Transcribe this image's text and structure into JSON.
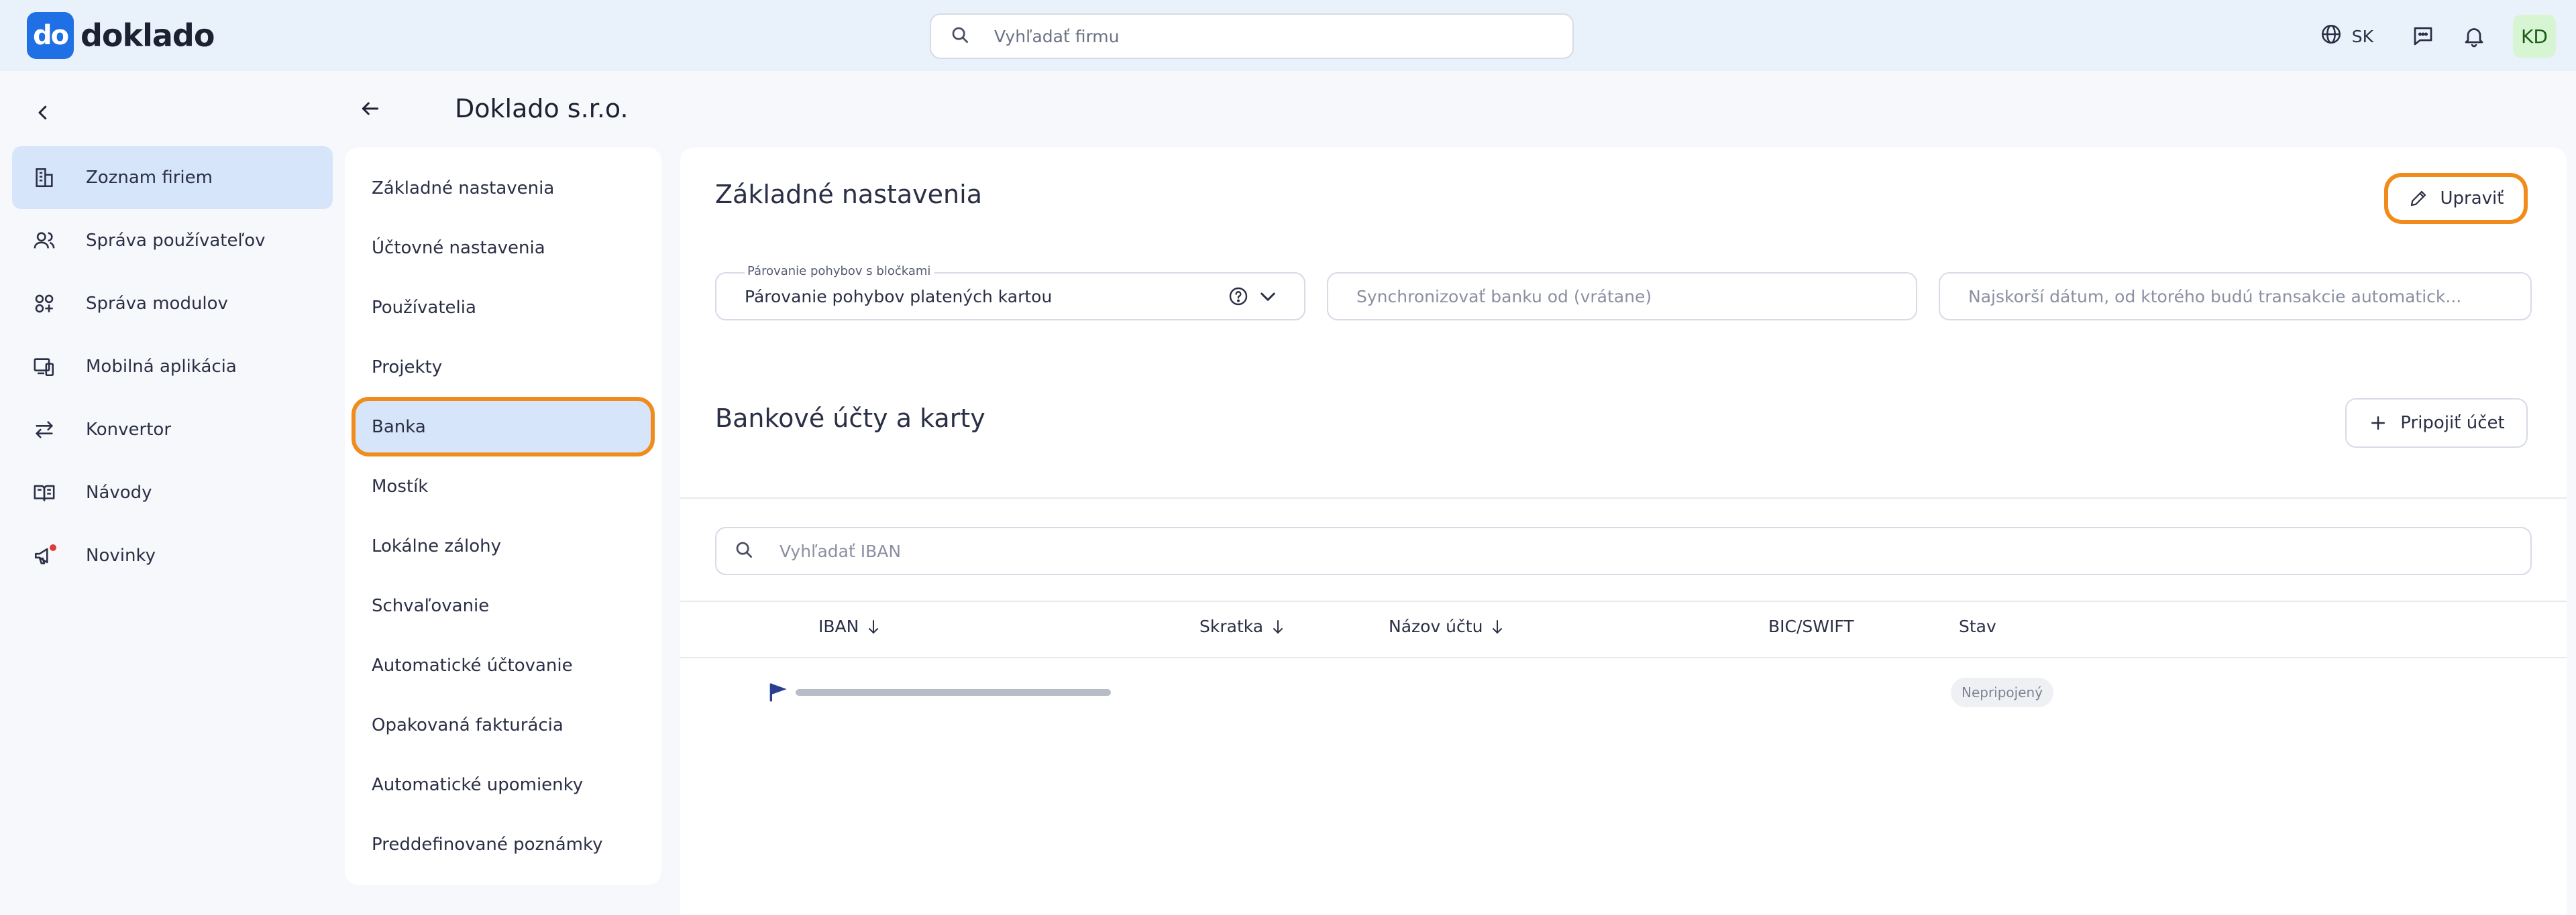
{
  "brand": {
    "logo_mark": "do",
    "name": "doklado",
    "color": "#1f6fe5"
  },
  "topbar": {
    "search_placeholder": "Vyhľadať firmu",
    "language": "SK",
    "avatar_initials": "KD",
    "icons": [
      "search-icon",
      "globe-icon",
      "chat-icon",
      "bell-icon"
    ]
  },
  "sidebar": {
    "items": [
      {
        "label": "Zoznam firiem",
        "icon": "building-icon",
        "active": true
      },
      {
        "label": "Správa používateľov",
        "icon": "users-icon"
      },
      {
        "label": "Správa modulov",
        "icon": "modules-icon"
      },
      {
        "label": "Mobilná aplikácia",
        "icon": "mobile-icon"
      },
      {
        "label": "Konvertor",
        "icon": "arrows-icon"
      },
      {
        "label": "Návody",
        "icon": "book-icon"
      },
      {
        "label": "Novinky",
        "icon": "megaphone-icon",
        "badge": true
      }
    ]
  },
  "company": {
    "title": "Doklado s.r.o."
  },
  "settings_menu": {
    "items": [
      "Základné nastavenia",
      "Účtovné nastavenia",
      "Používatelia",
      "Projekty",
      "Banka",
      "Mostík",
      "Lokálne zálohy",
      "Schvaľovanie",
      "Automatické účtovanie",
      "Opakovaná fakturácia",
      "Automatické upomienky",
      "Preddefinované poznámky"
    ],
    "active": "Banka"
  },
  "basic_settings": {
    "title": "Základné nastavenia",
    "edit_label": "Upraviť",
    "pairing_label": "Párovanie pohybov s bločkami",
    "pairing_value": "Párovanie pohybov platených kartou",
    "sync_placeholder": "Synchronizovať banku od (vrátane)",
    "earliest_placeholder": "Najskorší dátum, od ktorého budú transakcie automatick..."
  },
  "bank_accounts": {
    "title": "Bankové účty a karty",
    "connect_label": "Pripojiť účet",
    "search_placeholder": "Vyhľadať IBAN",
    "columns": [
      "IBAN",
      "Skratka",
      "Názov účtu",
      "BIC/SWIFT",
      "Stav"
    ],
    "rows": [
      {
        "iban": "",
        "skratka": "",
        "nazov": "",
        "bic": "",
        "stav": "Nepripojený"
      }
    ]
  },
  "colors": {
    "accent": "#f08c1c",
    "active_bg": "#d6e5f9",
    "topbar_bg": "#e9f1fb"
  }
}
